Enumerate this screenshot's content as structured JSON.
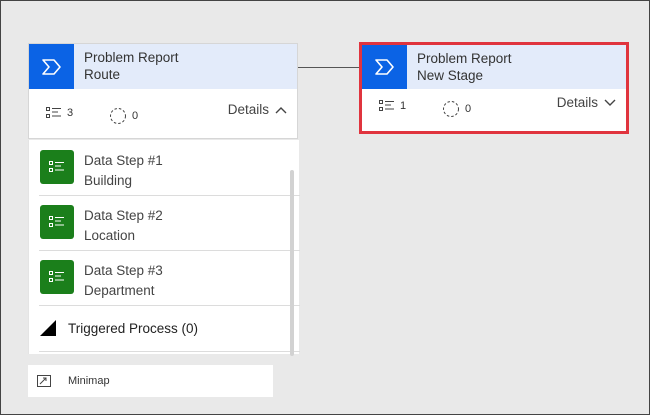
{
  "stages": [
    {
      "line1": "Problem Report",
      "line2": "Route",
      "steps_count": "3",
      "flows_count": "0",
      "details_label": "Details"
    },
    {
      "line1": "Problem Report",
      "line2": "New Stage",
      "steps_count": "1",
      "flows_count": "0",
      "details_label": "Details"
    }
  ],
  "data_steps": [
    {
      "title": "Data Step #1",
      "field": "Building"
    },
    {
      "title": "Data Step #2",
      "field": "Location"
    },
    {
      "title": "Data Step #3",
      "field": "Department"
    }
  ],
  "triggered_process_label": "Triggered Process (0)",
  "minimap_label": "Minimap",
  "colors": {
    "stage_accent": "#0b63e5",
    "stage_header_bg": "#e3ebfa",
    "step_icon_bg": "#1b7f1b",
    "selection_border": "#e0343e"
  },
  "icons": {
    "stage": "chevron-stage-icon",
    "steps": "step-list-icon",
    "flows": "flow-circle-icon",
    "data_step": "data-step-icon",
    "triggered": "triangle-icon",
    "minimap": "minimap-icon"
  }
}
